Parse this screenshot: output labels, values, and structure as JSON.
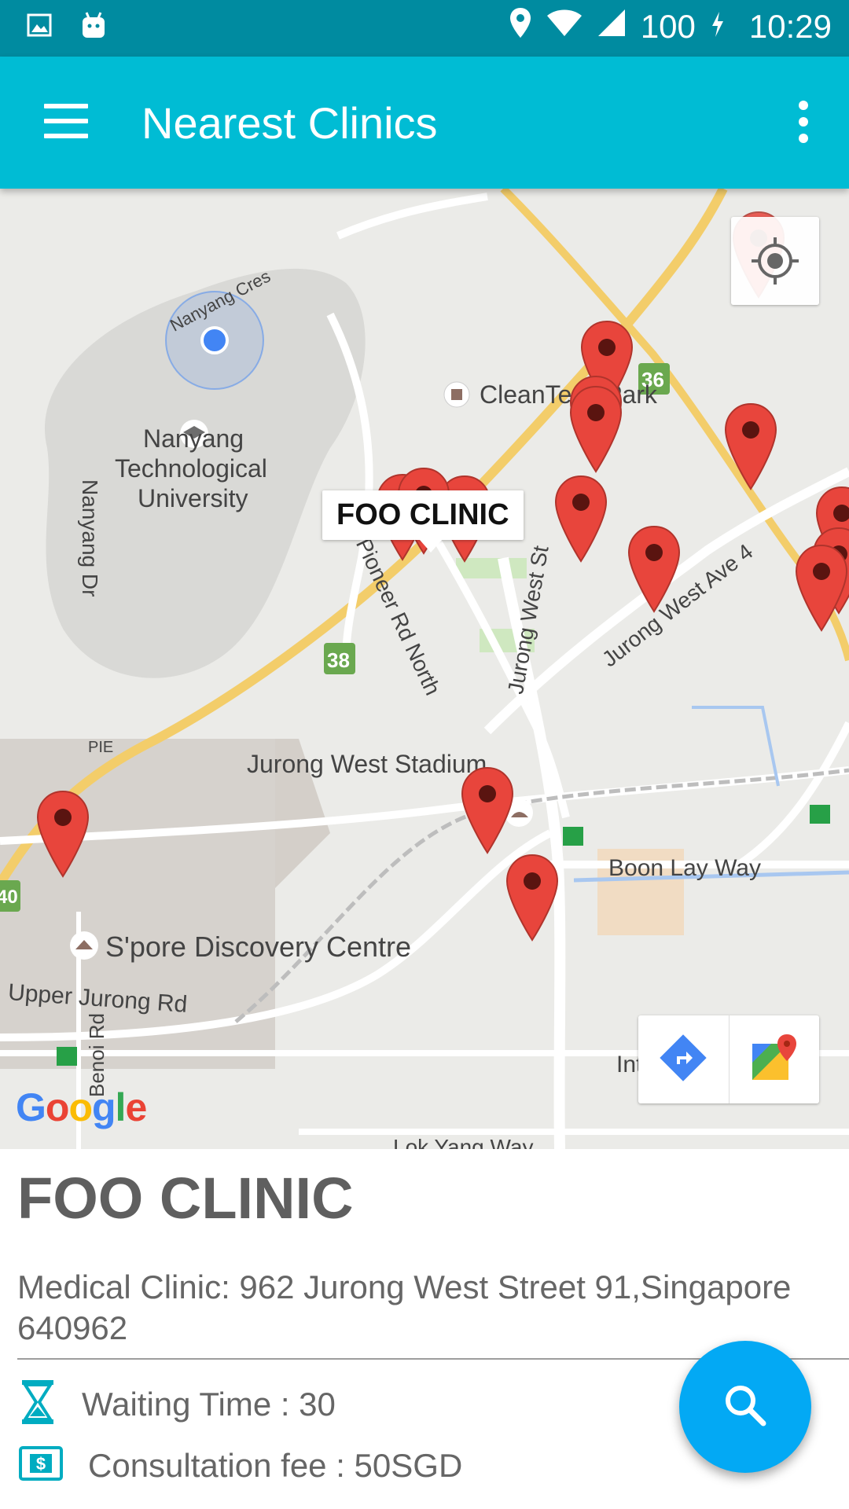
{
  "status_bar": {
    "icons_left": [
      "gallery-icon",
      "android-icon"
    ],
    "icons_right": [
      "location-icon",
      "wifi-icon",
      "cell-signal-icon",
      "battery-charging-icon"
    ],
    "battery": "100",
    "time": "10:29"
  },
  "app_bar": {
    "title": "Nearest Clinics",
    "menu_icon": "hamburger-menu-icon",
    "overflow_icon": "more-vert-icon"
  },
  "map": {
    "labels": {
      "nanyang_cres": "Nanyang Cres",
      "cleantech_park": "CleanTech Park",
      "ntu_line1": "Nanyang",
      "ntu_line2": "Technological",
      "ntu_line3": "University",
      "nanyang_dr": "Nanyang Dr",
      "jurong_west_ave": "Jurong West Ave 4",
      "jurong_west_st": "Jurong West St",
      "jurong_west_stadium": "Jurong West Stadium",
      "pie": "PIE",
      "boon_lay_way": "Boon Lay Way",
      "spore_discovery_centre": "S'pore Discovery Centre",
      "upper_jurong_rd": "Upper Jurong Rd",
      "benoi_rd": "Benoi Rd",
      "international": "International",
      "lok_yang_way": "Lok Yang Way",
      "pioneer_rd_north": "Pioneer Rd North"
    },
    "route_shields": [
      "36",
      "38",
      "40"
    ],
    "selected_marker_info": "FOO CLINIC",
    "brand": "Google",
    "my_location_icon": "my-location-icon",
    "toolbar": [
      "directions-icon",
      "google-maps-icon"
    ],
    "marker_color": "#e8453c"
  },
  "details": {
    "clinic_name": "FOO CLINIC",
    "address": "Medical Clinic: 962 Jurong West Street 91,Singapore 640962",
    "waiting_time": "Waiting Time : 30",
    "consultation_fee": "Consultation fee : 50SGD",
    "waiting_icon": "hourglass-icon",
    "fee_icon": "dollar-icon"
  },
  "fab": {
    "icon": "search-icon",
    "color": "#03a9f4"
  },
  "colors": {
    "app_bar": "#00bcd4",
    "status_bar": "#008ba0",
    "accent": "#00acc1"
  }
}
